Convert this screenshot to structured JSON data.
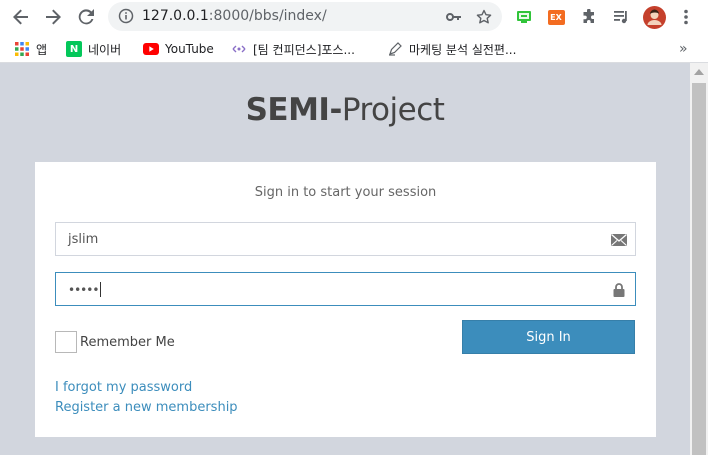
{
  "browser": {
    "url_host": "127.0.0.1",
    "url_port": ":8000",
    "url_path": "/bbs/index/",
    "nav": {
      "back_icon": "arrow-left-icon",
      "forward_icon": "arrow-right-icon",
      "reload_icon": "reload-icon"
    },
    "omnibox_icons": [
      "info-icon",
      "key-icon",
      "star-icon"
    ],
    "extension_icons": [
      "screen-extension-icon",
      "ex-extension-icon",
      "puzzle-icon",
      "media-queue-icon",
      "profile-avatar",
      "more-vert-icon"
    ],
    "ex_label": "EX"
  },
  "bookmarks": {
    "items": [
      {
        "label": "앱",
        "icon": "apps-grid-icon"
      },
      {
        "label": "네이버",
        "icon": "naver-icon",
        "icon_text": "N"
      },
      {
        "label": "YouTube",
        "icon": "youtube-icon"
      },
      {
        "label": "[팀 컨피던스]포스...",
        "icon": "web-icon"
      },
      {
        "label": "마케팅 분석 실전편...",
        "icon": "pen-icon"
      }
    ],
    "overflow": "»"
  },
  "page": {
    "logo_bold": "SEMI-",
    "logo_light": "Project",
    "box_msg": "Sign in to start your session",
    "username_value": "jslim",
    "password_value": "•••••",
    "remember_label": "Remember Me",
    "remember_checked": false,
    "sign_in_label": "Sign In",
    "forgot_link": "I forgot my password",
    "register_link": "Register a new membership"
  },
  "colors": {
    "page_bg": "#d2d6de",
    "accent": "#3c8dbc",
    "logo_text": "#444444"
  }
}
